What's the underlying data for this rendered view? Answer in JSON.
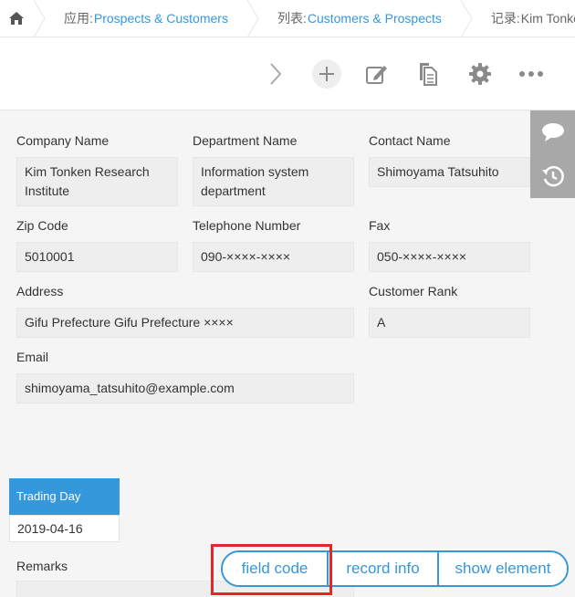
{
  "breadcrumb": {
    "app_prefix": "应用:",
    "app_name": "Prospects & Customers",
    "list_prefix": "列表:",
    "list_name": "Customers & Prospects",
    "record_prefix": "记录:",
    "record_name": "Kim Tonken Research Institute"
  },
  "toolbar": {
    "icons": [
      "next-record-icon",
      "add-icon",
      "edit-icon",
      "duplicate-icon",
      "gear-icon",
      "more-icon"
    ]
  },
  "fields": {
    "company_name": {
      "label": "Company Name",
      "value": "Kim Tonken Research Institute"
    },
    "department_name": {
      "label": "Department Name",
      "value": "Information system department"
    },
    "contact_name": {
      "label": "Contact Name",
      "value": "Shimoyama Tatsuhito"
    },
    "zip_code": {
      "label": "Zip Code",
      "value": "5010001"
    },
    "telephone": {
      "label": "Telephone Number",
      "value": "090-××××-××××"
    },
    "fax": {
      "label": "Fax",
      "value": "050-××××-××××"
    },
    "address": {
      "label": "Address",
      "value": "Gifu Prefecture Gifu Prefecture ××××"
    },
    "customer_rank": {
      "label": "Customer Rank",
      "value": "A"
    },
    "email": {
      "label": "Email",
      "value": "shimoyama_tatsuhito@example.com"
    },
    "trading_day": {
      "label": "Trading Day",
      "value": "2019-04-16"
    },
    "remarks": {
      "label": "Remarks",
      "value": ""
    }
  },
  "sidepanel": {
    "icons": [
      "comment-icon",
      "history-icon"
    ]
  },
  "floating_buttons": {
    "field_code": "field code",
    "record_info": "record info",
    "show_element": "show element"
  },
  "colors": {
    "accent": "#3498db",
    "highlight": "#e3262a",
    "background": "#f5f5f5"
  }
}
